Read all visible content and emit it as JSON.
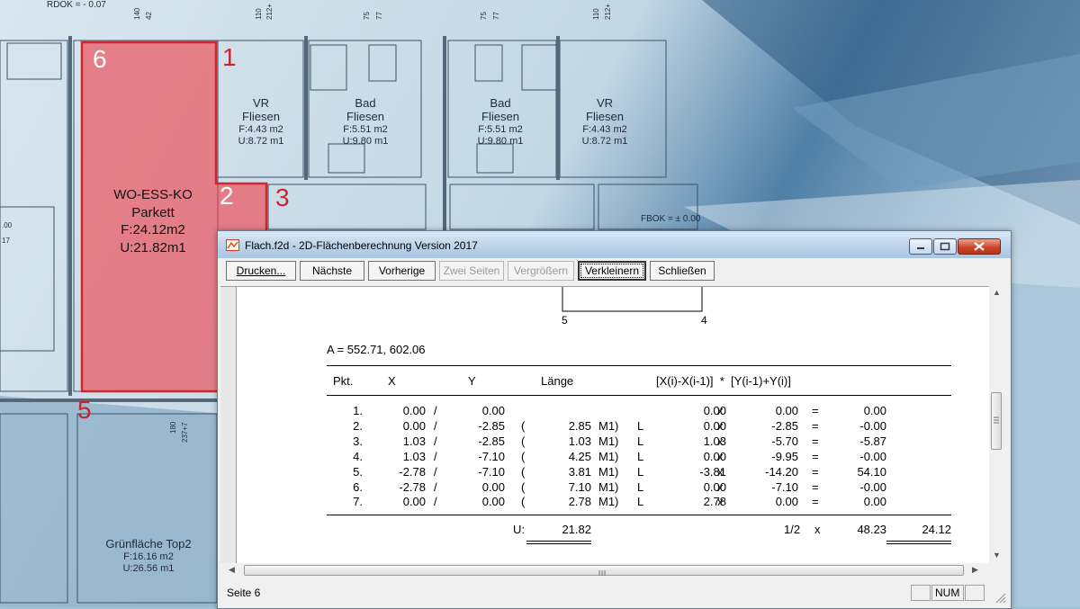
{
  "plan": {
    "top_left_label": "RDOK = - 0.07",
    "fbok_label": "FBOK = ± 0.00",
    "rooms": [
      {
        "name": "VR",
        "finish": "Fliesen",
        "area": "F:4.43 m2",
        "perimeter": "U:8.72 m1"
      },
      {
        "name": "Bad",
        "finish": "Fliesen",
        "area": "F:5.51 m2",
        "perimeter": "U:9.80 m1"
      },
      {
        "name": "Bad",
        "finish": "Fliesen",
        "area": "F:5.51 m2",
        "perimeter": "U:9.80 m1"
      },
      {
        "name": "VR",
        "finish": "Fliesen",
        "area": "F:4.43 m2",
        "perimeter": "U:8.72 m1"
      },
      {
        "name": "Grünfläche Top2",
        "finish": "",
        "area": "F:16.16 m2",
        "perimeter": "U:26.56 m1"
      }
    ],
    "highlight_room": {
      "name": "WO-ESS-KO",
      "finish": "Parkett",
      "area": "F:24.12m2",
      "perimeter": "U:21.82m1"
    },
    "point_numbers": [
      "6",
      "1",
      "2",
      "3",
      "5",
      "4"
    ]
  },
  "window": {
    "title": "Flach.f2d - 2D-Flächenberechnung Version 2017",
    "toolbar": {
      "print": "Drucken...",
      "next": "Nächste",
      "prev": "Vorherige",
      "two_pages": "Zwei Seiten",
      "zoom_in": "Vergrößern",
      "zoom_out": "Verkleinern",
      "close": "Schließen"
    },
    "status": {
      "page": "Seite 6",
      "num": "NUM"
    }
  },
  "report": {
    "sketch_labels": [
      "5",
      "4"
    ],
    "point_a": "A = 552.71, 602.06",
    "headers": {
      "pkt": "Pkt.",
      "x": "X",
      "y": "Y",
      "laenge": "Länge",
      "formula": "[X(i)-X(i-1)]  *  [Y(i-1)+Y(i)]"
    },
    "rows": [
      {
        "pkt": "1.",
        "x": "0.00",
        "y": "0.00",
        "len": "",
        "dx": "0.00",
        "sy": "0.00",
        "res": "0.00"
      },
      {
        "pkt": "2.",
        "x": "0.00",
        "y": "-2.85",
        "len": "2.85",
        "dx": "0.00",
        "sy": "-2.85",
        "res": "-0.00"
      },
      {
        "pkt": "3.",
        "x": "1.03",
        "y": "-2.85",
        "len": "1.03",
        "dx": "1.03",
        "sy": "-5.70",
        "res": "-5.87"
      },
      {
        "pkt": "4.",
        "x": "1.03",
        "y": "-7.10",
        "len": "4.25",
        "dx": "0.00",
        "sy": "-9.95",
        "res": "-0.00"
      },
      {
        "pkt": "5.",
        "x": "-2.78",
        "y": "-7.10",
        "len": "3.81",
        "dx": "-3.81",
        "sy": "-14.20",
        "res": "54.10"
      },
      {
        "pkt": "6.",
        "x": "-2.78",
        "y": "0.00",
        "len": "7.10",
        "dx": "0.00",
        "sy": "-7.10",
        "res": "-0.00"
      },
      {
        "pkt": "7.",
        "x": "0.00",
        "y": "0.00",
        "len": "2.78",
        "dx": "2.78",
        "sy": "0.00",
        "res": "0.00"
      }
    ],
    "slash": "/",
    "paren": "(",
    "m1": "M1)",
    "l": "L",
    "x_op": "x",
    "eq": "=",
    "total_u_label": "U:",
    "total_u": "21.82",
    "total_half": "1/2",
    "total_x": "x",
    "total_sum": "48.23",
    "total_area": "24.12"
  }
}
